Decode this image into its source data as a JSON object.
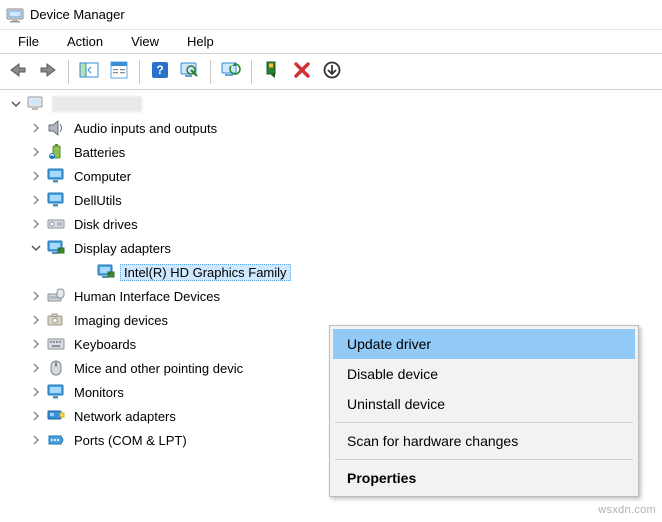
{
  "window": {
    "title": "Device Manager"
  },
  "menu": {
    "file": "File",
    "action": "Action",
    "view": "View",
    "help": "Help"
  },
  "tree": {
    "root": "",
    "audio": "Audio inputs and outputs",
    "batteries": "Batteries",
    "computer": "Computer",
    "dellutils": "DellUtils",
    "disk": "Disk drives",
    "display": "Display adapters",
    "display_child": "Intel(R) HD Graphics Family",
    "hid": "Human Interface Devices",
    "imaging": "Imaging devices",
    "keyboards": "Keyboards",
    "mice": "Mice and other pointing devic",
    "monitors": "Monitors",
    "network": "Network adapters",
    "ports": "Ports (COM & LPT)"
  },
  "context": {
    "update": "Update driver",
    "disable": "Disable device",
    "uninstall": "Uninstall device",
    "scan": "Scan for hardware changes",
    "properties": "Properties"
  },
  "watermark": "wsxdn.com"
}
